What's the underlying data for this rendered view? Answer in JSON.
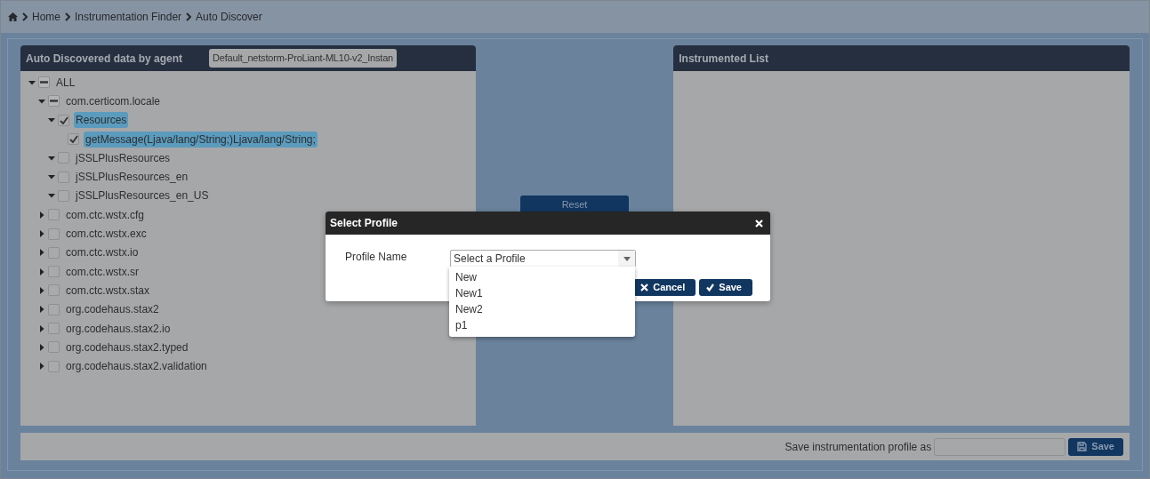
{
  "breadcrumb": [
    {
      "label": "Home"
    },
    {
      "label": "Instrumentation Finder"
    },
    {
      "label": "Auto Discover"
    }
  ],
  "left_panel": {
    "title": "Auto Discovered data by agent",
    "agent_field": {
      "value": "Default_netstorm-ProLiant-ML10-v2_Instan"
    },
    "tree": [
      {
        "label": "ALL",
        "indeterminate": true,
        "selected": false,
        "expanded": true,
        "children": [
          {
            "label": "com.certicom.locale",
            "indeterminate": true,
            "selected": false,
            "expanded": true,
            "children": [
              {
                "label": "Resources",
                "checked": true,
                "selected": true,
                "expanded": true,
                "children": [
                  {
                    "label": "getMessage(Ljava/lang/String;)Ljava/lang/String;",
                    "checked": true,
                    "selected": true
                  }
                ]
              },
              {
                "label": "jSSLPlusResources",
                "checked": false,
                "selected": false,
                "expanded": true
              },
              {
                "label": "jSSLPlusResources_en",
                "checked": false,
                "selected": false,
                "expanded": true
              },
              {
                "label": "jSSLPlusResources_en_US",
                "checked": false,
                "selected": false,
                "expanded": true
              }
            ]
          },
          {
            "label": "com.ctc.wstx.cfg",
            "checked": false,
            "selected": false,
            "expanded": false
          },
          {
            "label": "com.ctc.wstx.exc",
            "checked": false,
            "selected": false,
            "expanded": false
          },
          {
            "label": "com.ctc.wstx.io",
            "checked": false,
            "selected": false,
            "expanded": false
          },
          {
            "label": "com.ctc.wstx.sr",
            "checked": false,
            "selected": false,
            "expanded": false
          },
          {
            "label": "com.ctc.wstx.stax",
            "checked": false,
            "selected": false,
            "expanded": false
          },
          {
            "label": "org.codehaus.stax2",
            "checked": false,
            "selected": false,
            "expanded": false
          },
          {
            "label": "org.codehaus.stax2.io",
            "checked": false,
            "selected": false,
            "expanded": false
          },
          {
            "label": "org.codehaus.stax2.typed",
            "checked": false,
            "selected": false,
            "expanded": false
          },
          {
            "label": "org.codehaus.stax2.validation",
            "checked": false,
            "selected": false,
            "expanded": false
          }
        ]
      }
    ]
  },
  "reset_button": "Reset",
  "right_panel": {
    "title": "Instrumented List"
  },
  "footer": {
    "label": "Save instrumentation profile as",
    "save_button": "Save"
  },
  "dialog": {
    "title": "Select Profile",
    "field_label": "Profile Name",
    "select": {
      "placeholder": "Select a Profile",
      "expanded": true,
      "options": [
        {
          "label": "New"
        },
        {
          "label": "New1"
        },
        {
          "label": "New2"
        },
        {
          "label": "p1"
        }
      ]
    },
    "buttons": [
      {
        "kind": "cancel",
        "label": "Cancel"
      },
      {
        "kind": "save",
        "label": "Save"
      }
    ]
  }
}
